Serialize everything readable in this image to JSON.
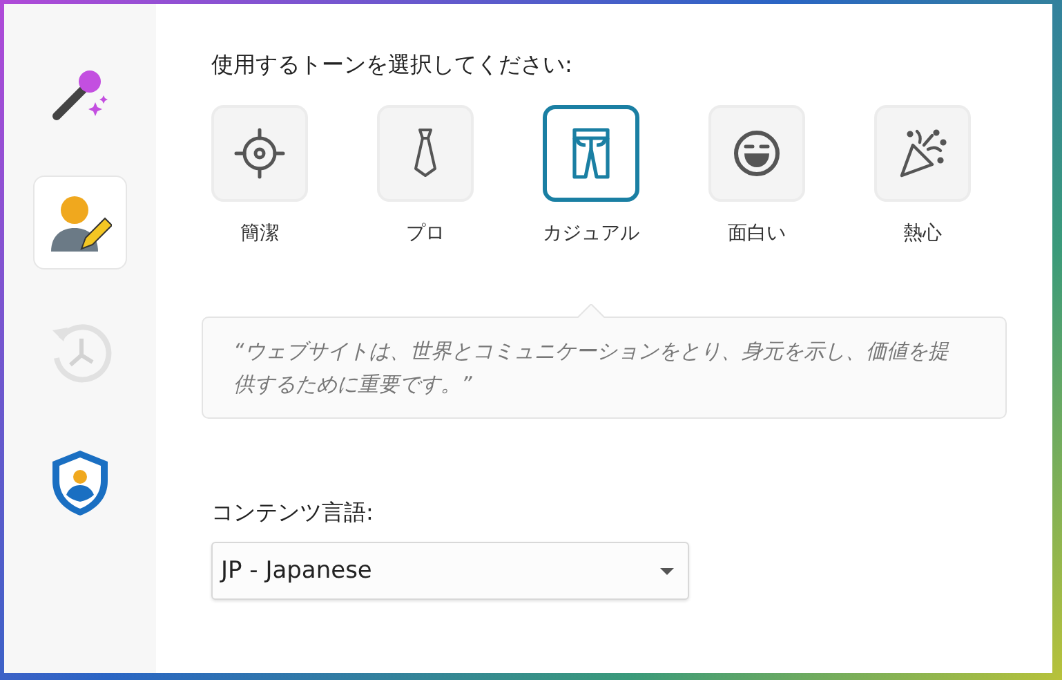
{
  "sidebar": {
    "items": [
      {
        "kind": "wand",
        "selected": false,
        "disabled": false
      },
      {
        "kind": "person-edit",
        "selected": true,
        "disabled": false
      },
      {
        "kind": "history",
        "selected": false,
        "disabled": true
      },
      {
        "kind": "shield",
        "selected": false,
        "disabled": false
      }
    ]
  },
  "tone_prompt": "使用するトーンを選択してください:",
  "tones": [
    {
      "kind": "target",
      "label": "簡潔",
      "selected": false
    },
    {
      "kind": "tie",
      "label": "プロ",
      "selected": false
    },
    {
      "kind": "pants",
      "label": "カジュアル",
      "selected": true
    },
    {
      "kind": "smile",
      "label": "面白い",
      "selected": false
    },
    {
      "kind": "party",
      "label": "熱心",
      "selected": false
    }
  ],
  "sample_text": "“ウェブサイトは、世界とコミュニケーションをとり、身元を示し、価値を提供するために重要です。”",
  "language": {
    "label": "コンテンツ言語:",
    "value": "JP - Japanese"
  }
}
